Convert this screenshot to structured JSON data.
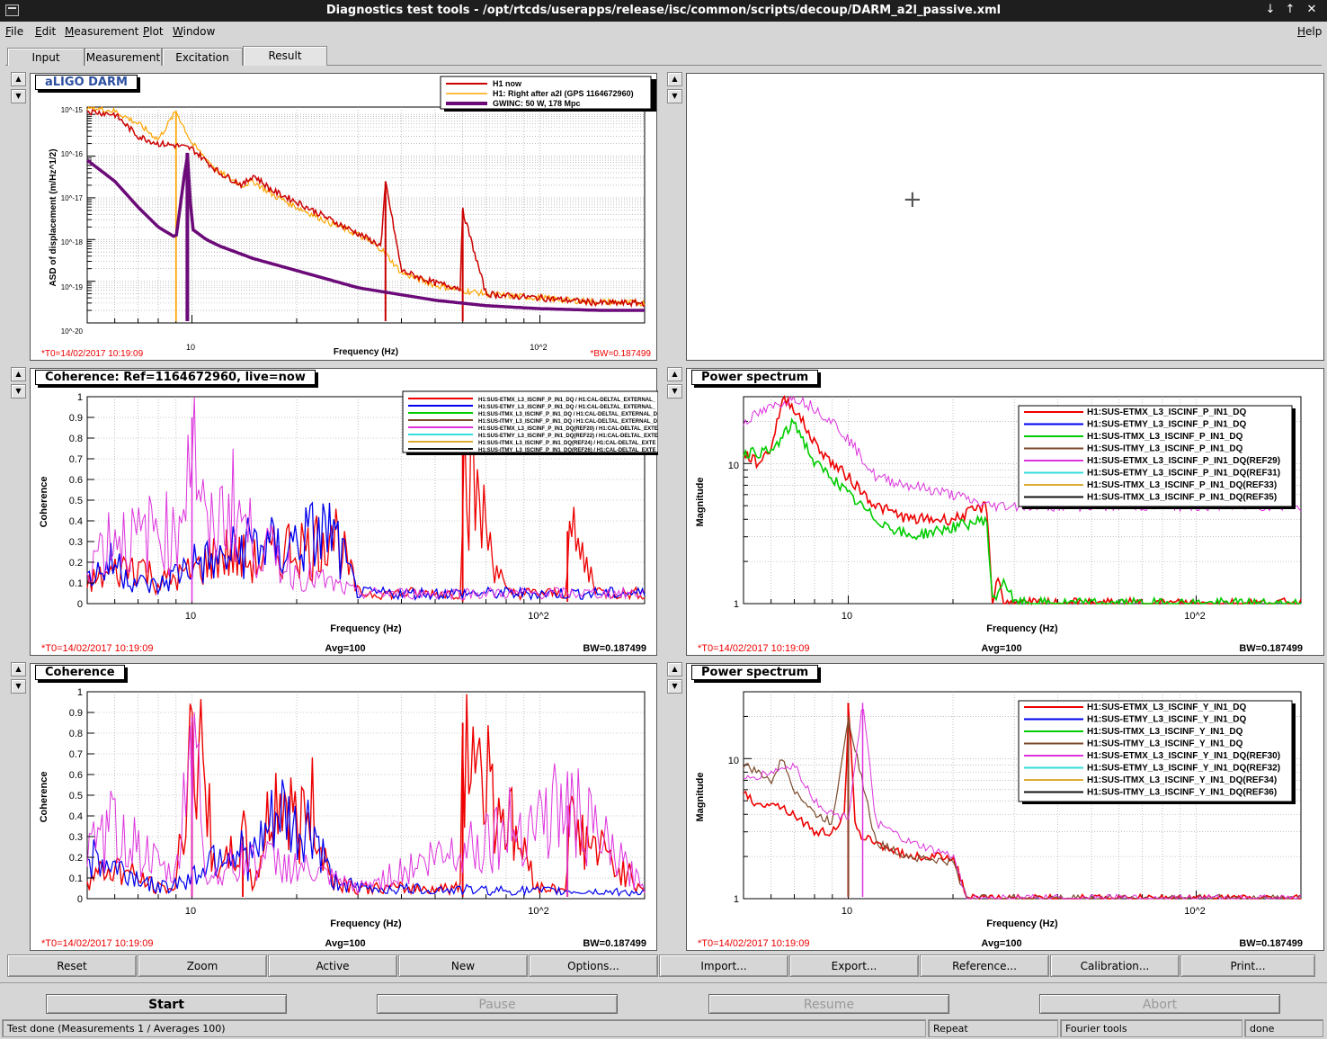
{
  "window": {
    "title": "Diagnostics test tools - /opt/rtcds/userapps/release/isc/common/scripts/decoup/DARM_a2l_passive.xml",
    "btn_min": "↓",
    "btn_max": "↑",
    "btn_close": "✕"
  },
  "menu": {
    "file": "File",
    "edit": "Edit",
    "measurement": "Measurement",
    "plot": "Plot",
    "window": "Window",
    "help": "Help"
  },
  "tabs": [
    "Input",
    "Measurement",
    "Excitation",
    "Result"
  ],
  "active_tab": "Result",
  "arrows": {
    "up": "▲",
    "down": "▼"
  },
  "panels": {
    "p1": {
      "title": "aLIGO DARM",
      "ylabel": "ASD of displacement (m/Hz^1/2)",
      "xlabel": "Frequency (Hz)",
      "t0": "*T0=14/02/2017 10:19:09",
      "bw": "*BW=0.187499",
      "xticks": [
        "10",
        "10^2"
      ],
      "yticks": [
        "10^-15",
        "10^-16",
        "10^-17",
        "10^-18",
        "10^-19",
        "10^-20"
      ],
      "legend": [
        {
          "label": "H1 now",
          "color": "#cc0000"
        },
        {
          "label": "H1: Right after a2l (GPS 1164672960)",
          "color": "#ffa500"
        },
        {
          "label": "GWINC: 50 W, 178 Mpc",
          "color": "#6b0a78"
        }
      ]
    },
    "p2": {
      "cursor": "+"
    },
    "p3": {
      "title": "Coherence: Ref=1164672960, live=now",
      "ylabel": "Coherence",
      "xlabel": "Frequency (Hz)",
      "t0": "*T0=14/02/2017 10:19:09",
      "avg": "Avg=100",
      "bw": "BW=0.187499",
      "xticks": [
        "10",
        "10^2"
      ],
      "yticks": [
        "1",
        "0.9",
        "0.8",
        "0.7",
        "0.6",
        "0.5",
        "0.4",
        "0.3",
        "0.2",
        "0.1",
        "0"
      ],
      "legend": [
        {
          "label": "H1:SUS-ETMX_L3_ISCINF_P_IN1_DQ / H1:CAL-DELTAL_EXTERNAL_",
          "color": "#ee0000"
        },
        {
          "label": "H1:SUS-ETMY_L3_ISCINF_P_IN1_DQ / H1:CAL-DELTAL_EXTERNAL_",
          "color": "#0000ee"
        },
        {
          "label": "H1:SUS-ITMX_L3_ISCINF_P_IN1_DQ / H1:CAL-DELTAL_EXTERNAL_D",
          "color": "#00cc00"
        },
        {
          "label": "H1:SUS-ITMY_L3_ISCINF_P_IN1_DQ / H1:CAL-DELTAL_EXTERNAL_D",
          "color": "#7b4a2a"
        },
        {
          "label": "H1:SUS-ETMX_L3_ISCINF_P_IN1_DQ(REF20) / H1:CAL-DELTAL_EXTE",
          "color": "#dd33dd"
        },
        {
          "label": "H1:SUS-ETMY_L3_ISCINF_P_IN1_DQ(REF22) / H1:CAL-DELTAL_EXTE",
          "color": "#33dddd"
        },
        {
          "label": "H1:SUS-ITMX_L3_ISCINF_P_IN1_DQ(REF24) / H1:CAL-DELTAL_EXTE",
          "color": "#ddaa33"
        },
        {
          "label": "H1:SUS-ITMY_L3_ISCINF_P_IN1_DQ(REF26) / H1:CAL-DELTAL_EXTE",
          "color": "#111111"
        }
      ]
    },
    "p4": {
      "title": "Power spectrum",
      "ylabel": "Magnitude",
      "xlabel": "Frequency (Hz)",
      "t0": "*T0=14/02/2017 10:19:09",
      "avg": "Avg=100",
      "bw": "BW=0.187499",
      "xticks": [
        "10",
        "10^2"
      ],
      "yticks": [
        "10",
        "1"
      ],
      "legend": [
        {
          "label": "H1:SUS-ETMX_L3_ISCINF_P_IN1_DQ",
          "color": "#ee0000"
        },
        {
          "label": "H1:SUS-ETMY_L3_ISCINF_P_IN1_DQ",
          "color": "#0000ee"
        },
        {
          "label": "H1:SUS-ITMX_L3_ISCINF_P_IN1_DQ",
          "color": "#00cc00"
        },
        {
          "label": "H1:SUS-ITMY_L3_ISCINF_P_IN1_DQ",
          "color": "#7b4a2a"
        },
        {
          "label": "H1:SUS-ETMX_L3_ISCINF_P_IN1_DQ(REF29)",
          "color": "#dd33dd"
        },
        {
          "label": "H1:SUS-ETMY_L3_ISCINF_P_IN1_DQ(REF31)",
          "color": "#33dddd"
        },
        {
          "label": "H1:SUS-ITMX_L3_ISCINF_P_IN1_DQ(REF33)",
          "color": "#ddaa33"
        },
        {
          "label": "H1:SUS-ITMX_L3_ISCINF_P_IN1_DQ(REF35)",
          "color": "#111111"
        }
      ]
    },
    "p5": {
      "title": "Coherence",
      "ylabel": "Coherence",
      "xlabel": "Frequency (Hz)",
      "t0": "*T0=14/02/2017 10:19:09",
      "avg": "Avg=100",
      "bw": "BW=0.187499",
      "xticks": [
        "10",
        "10^2"
      ],
      "yticks": [
        "1",
        "0.9",
        "0.8",
        "0.7",
        "0.6",
        "0.5",
        "0.4",
        "0.3",
        "0.2",
        "0.1",
        "0"
      ]
    },
    "p6": {
      "title": "Power spectrum",
      "ylabel": "Magnitude",
      "xlabel": "Frequency (Hz)",
      "t0": "*T0=14/02/2017 10:19:09",
      "avg": "Avg=100",
      "bw": "BW=0.187499",
      "xticks": [
        "10",
        "10^2"
      ],
      "yticks": [
        "10",
        "1"
      ],
      "legend": [
        {
          "label": "H1:SUS-ETMX_L3_ISCINF_Y_IN1_DQ",
          "color": "#ee0000"
        },
        {
          "label": "H1:SUS-ETMY_L3_ISCINF_Y_IN1_DQ",
          "color": "#0000ee"
        },
        {
          "label": "H1:SUS-ITMX_L3_ISCINF_Y_IN1_DQ",
          "color": "#00cc00"
        },
        {
          "label": "H1:SUS-ITMY_L3_ISCINF_Y_IN1_DQ",
          "color": "#7b4a2a"
        },
        {
          "label": "H1:SUS-ETMX_L3_ISCINF_Y_IN1_DQ(REF30)",
          "color": "#dd33dd"
        },
        {
          "label": "H1:SUS-ETMY_L3_ISCINF_Y_IN1_DQ(REF32)",
          "color": "#33dddd"
        },
        {
          "label": "H1:SUS-ITMX_L3_ISCINF_Y_IN1_DQ(REF34)",
          "color": "#ddaa33"
        },
        {
          "label": "H1:SUS-ITMY_L3_ISCINF_Y_IN1_DQ(REF36)",
          "color": "#111111"
        }
      ]
    }
  },
  "buttons": [
    "Reset",
    "Zoom",
    "Active",
    "New",
    "Options...",
    "Import...",
    "Export...",
    "Reference...",
    "Calibration...",
    "Print..."
  ],
  "controls": {
    "start": "Start",
    "pause": "Pause",
    "resume": "Resume",
    "abort": "Abort"
  },
  "status": {
    "main": "Test done (Measurements 1 / Averages 100)",
    "mode": "Repeat",
    "tool": "Fourier tools",
    "state": "done"
  },
  "chart_data": [
    {
      "type": "line",
      "title": "aLIGO DARM",
      "xlabel": "Frequency (Hz)",
      "ylabel": "ASD of displacement (m/Hz^1/2)",
      "xscale": "log",
      "yscale": "log",
      "xlim": [
        5,
        200
      ],
      "ylim": [
        1e-20,
        1.5e-15
      ],
      "series": [
        {
          "name": "H1 now",
          "x": [
            5,
            6,
            7,
            8,
            9,
            10,
            12,
            14,
            15,
            17,
            20,
            25,
            30,
            35,
            36,
            40,
            50,
            59,
            60,
            70,
            80,
            100,
            120,
            150,
            200
          ],
          "y": [
            1.2e-15,
            1e-15,
            3e-16,
            2e-16,
            1.8e-16,
            1.5e-16,
            4e-17,
            2e-17,
            3.5e-17,
            1.5e-17,
            8e-18,
            3e-18,
            1.4e-18,
            7e-19,
            2.5e-17,
            1.8e-19,
            9e-20,
            7e-20,
            5e-18,
            5e-20,
            4.5e-20,
            4e-20,
            3.5e-20,
            3e-20,
            3e-20
          ]
        },
        {
          "name": "H1: Right after a2l (GPS 1164672960)",
          "x": [
            5,
            6,
            7,
            8,
            9,
            10,
            12,
            14,
            15,
            17,
            20,
            25,
            30,
            35,
            40,
            50,
            60,
            70,
            80,
            100,
            120,
            150,
            200
          ],
          "y": [
            1.5e-15,
            1.2e-15,
            6e-16,
            2.5e-16,
            1.2e-15,
            2e-16,
            4e-17,
            2e-17,
            2.5e-17,
            1.2e-17,
            6e-18,
            2.5e-18,
            1.3e-18,
            6e-19,
            1.6e-19,
            8e-20,
            6e-20,
            5e-20,
            4.5e-20,
            4e-20,
            3.5e-20,
            3.2e-20,
            3e-20
          ]
        },
        {
          "name": "GWINC: 50 W, 178 Mpc",
          "x": [
            5,
            6,
            7,
            8,
            9,
            9.7,
            10,
            11,
            12,
            15,
            20,
            30,
            50,
            70,
            100,
            150,
            200
          ],
          "y": [
            8e-17,
            2.5e-17,
            6e-18,
            2e-18,
            1.1e-18,
            1.2e-16,
            1.8e-18,
            1e-18,
            7e-19,
            3.5e-19,
            1.8e-19,
            7e-20,
            3.5e-20,
            2.6e-20,
            2.2e-20,
            2e-20,
            2e-20
          ]
        }
      ]
    },
    {
      "type": "line",
      "title": "Coherence: Ref=1164672960, live=now",
      "xlabel": "Frequency (Hz)",
      "ylabel": "Coherence",
      "xscale": "log",
      "xlim": [
        5,
        200
      ],
      "ylim": [
        0,
        1
      ],
      "series": [
        {
          "name": "H1:SUS-ETMX_L3_ISCINF_P_IN1_DQ / H1:CAL-DELTAL_EXTERNAL_",
          "x": [
            5,
            6,
            7,
            8,
            10,
            12,
            15,
            18,
            20,
            22,
            25,
            30,
            40,
            59,
            60,
            80,
            119,
            120,
            150,
            200
          ],
          "y": [
            0.1,
            0.15,
            0.2,
            0.1,
            0.15,
            0.25,
            0.2,
            0.25,
            0.3,
            0.25,
            0.4,
            0.05,
            0.05,
            0.05,
            0.72,
            0.05,
            0.05,
            0.35,
            0.05,
            0.05
          ]
        },
        {
          "name": "H1:SUS-ETMY_L3_ISCINF_P_IN1_DQ / H1:CAL-DELTAL_EXTERNAL_",
          "x": [
            5,
            6,
            7,
            8,
            10,
            12,
            15,
            18,
            20,
            25,
            30,
            40,
            60,
            100,
            200
          ],
          "y": [
            0.12,
            0.2,
            0.1,
            0.08,
            0.2,
            0.2,
            0.3,
            0.25,
            0.3,
            0.35,
            0.05,
            0.05,
            0.05,
            0.05,
            0.05
          ]
        },
        {
          "name": "H1:SUS-ETMX_L3_ISCINF_P_IN1_DQ(REF20) / H1:CAL-DELTAL_EXTE",
          "x": [
            5,
            6,
            7,
            8,
            9,
            10,
            11,
            13,
            15,
            20,
            30,
            60,
            200
          ],
          "y": [
            0.2,
            0.35,
            0.3,
            0.38,
            0.3,
            0.9,
            0.3,
            0.5,
            0.3,
            0.15,
            0.05,
            0.05,
            0.05
          ]
        }
      ]
    },
    {
      "type": "line",
      "title": "Power spectrum",
      "xlabel": "Frequency (Hz)",
      "ylabel": "Magnitude",
      "xscale": "log",
      "yscale": "log",
      "xlim": [
        5,
        200
      ],
      "ylim": [
        1,
        30
      ],
      "series": [
        {
          "name": "H1:SUS-ETMX_L3_ISCINF_P_IN1_DQ",
          "x": [
            5,
            5.5,
            6,
            6.5,
            7,
            8,
            9,
            10,
            12,
            15,
            20,
            25,
            26,
            27,
            28,
            30,
            200
          ],
          "y": [
            12,
            10,
            13,
            30,
            25,
            14,
            10,
            8,
            5,
            4,
            4,
            5,
            1,
            1.6,
            1,
            1,
            1
          ]
        },
        {
          "name": "H1:SUS-ITMX_L3_ISCINF_P_IN1_DQ",
          "x": [
            5,
            6,
            7,
            8,
            9,
            10,
            12,
            15,
            20,
            25,
            26,
            28,
            30
          ],
          "y": [
            12,
            12,
            20,
            10,
            8,
            6,
            4,
            3,
            3.5,
            4,
            1,
            1.5,
            1
          ]
        },
        {
          "name": "H1:SUS-ETMX_L3_ISCINF_P_IN1_DQ(REF29)",
          "x": [
            5,
            6,
            7,
            8,
            9,
            10,
            12,
            15,
            20,
            25
          ],
          "y": [
            20,
            25,
            30,
            25,
            20,
            15,
            8,
            7,
            6,
            5
          ]
        }
      ]
    },
    {
      "type": "line",
      "title": "Coherence",
      "xlabel": "Frequency (Hz)",
      "ylabel": "Coherence",
      "xscale": "log",
      "xlim": [
        5,
        200
      ],
      "ylim": [
        0,
        1
      ],
      "series": [
        {
          "name": "red",
          "x": [
            5,
            6,
            7,
            8,
            9,
            10,
            12,
            14,
            15,
            17,
            18,
            20,
            22,
            25,
            30,
            59,
            60,
            100,
            119,
            120,
            200
          ],
          "y": [
            0.1,
            0.15,
            0.1,
            0.05,
            0.05,
            0.85,
            0.1,
            0.3,
            0.05,
            0.45,
            0.5,
            0.35,
            0.45,
            0.1,
            0.05,
            0.05,
            0.85,
            0.05,
            0.05,
            0.35,
            0.05
          ]
        },
        {
          "name": "blue",
          "x": [
            5,
            6,
            7,
            8,
            10,
            12,
            15,
            18,
            20,
            22,
            25,
            30,
            200
          ],
          "y": [
            0.2,
            0.15,
            0.1,
            0.05,
            0.1,
            0.25,
            0.2,
            0.4,
            0.3,
            0.35,
            0.1,
            0.05,
            0.03
          ]
        },
        {
          "name": "magenta",
          "x": [
            5,
            6,
            7,
            8,
            9,
            10,
            11,
            15,
            20,
            30,
            120,
            200
          ],
          "y": [
            0.2,
            0.35,
            0.25,
            0.15,
            0.1,
            0.88,
            0.1,
            0.2,
            0.15,
            0.05,
            0.45,
            0.05
          ]
        }
      ]
    },
    {
      "type": "line",
      "title": "Power spectrum",
      "xlabel": "Frequency (Hz)",
      "ylabel": "Magnitude",
      "xscale": "log",
      "yscale": "log",
      "xlim": [
        5,
        200
      ],
      "ylim": [
        1,
        30
      ],
      "series": [
        {
          "name": "H1:SUS-ETMX_L3_ISCINF_Y_IN1_DQ",
          "x": [
            5,
            5.5,
            6,
            7,
            8,
            9,
            9.8,
            10,
            10.5,
            12,
            15,
            20,
            22
          ],
          "y": [
            6,
            4.5,
            5,
            4,
            3,
            3,
            4,
            25,
            3,
            2.5,
            2,
            2,
            1
          ]
        },
        {
          "name": "H1:SUS-ITMY_L3_ISCINF_Y_IN1_DQ",
          "x": [
            5,
            6,
            6.5,
            7,
            8,
            9,
            10,
            12,
            15,
            20,
            22
          ],
          "y": [
            9,
            7,
            10,
            6,
            4,
            3.5,
            20,
            2.5,
            2,
            1.8,
            1
          ]
        },
        {
          "name": "H1:SUS-ETMX_L3_ISCINF_Y_IN1_DQ(REF30)",
          "x": [
            5,
            6,
            7,
            8,
            9,
            10,
            11,
            12,
            15,
            20,
            22
          ],
          "y": [
            7,
            8,
            9,
            5,
            4,
            3.8,
            25,
            3.5,
            2.5,
            2,
            1
          ]
        }
      ]
    }
  ]
}
